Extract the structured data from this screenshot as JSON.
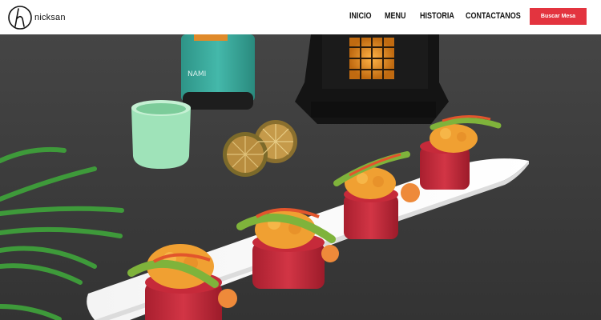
{
  "brand": {
    "name": "nicksan",
    "logo_letter": "h"
  },
  "nav": {
    "items": [
      {
        "label": "INICIO"
      },
      {
        "label": "MENU"
      },
      {
        "label": "HISTORIA"
      },
      {
        "label": "CONTACTANOS"
      }
    ],
    "cta_label": "Buscar Mesa"
  },
  "hero": {
    "bottle_label": "NAMI"
  },
  "colors": {
    "header_bg": "#ffffff",
    "cta_bg": "#e3343f",
    "hero_bg": "#3d3d3d",
    "tuna": "#c62a3a",
    "avocado": "#7fb33b",
    "cup": "#9fe0b8",
    "bottle": "#3aa99c"
  }
}
